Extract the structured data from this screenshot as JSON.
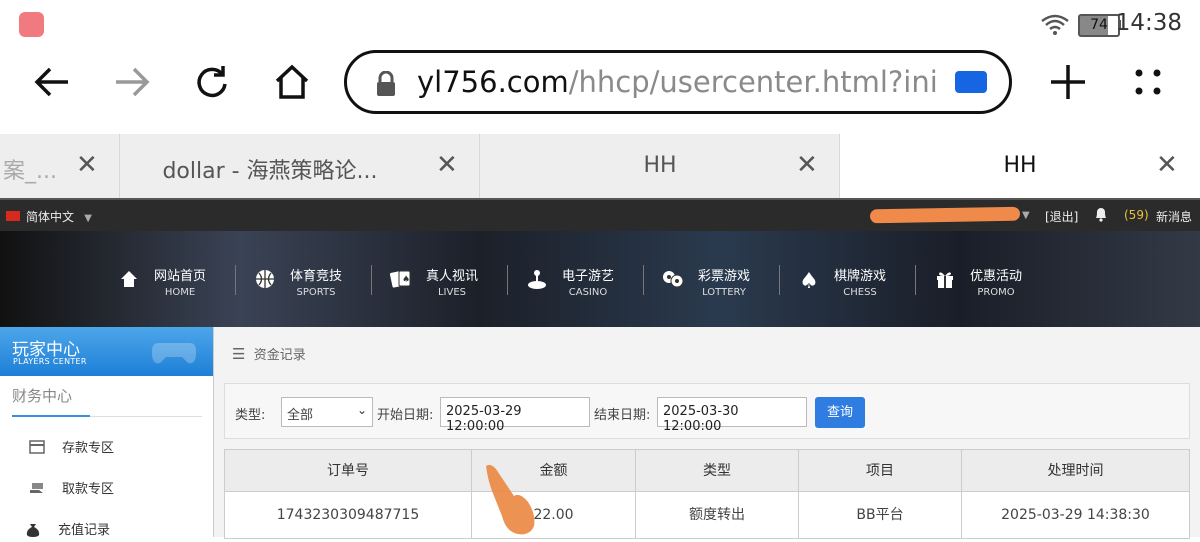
{
  "status": {
    "time": "14:38",
    "battery": "74",
    "wifi_icon": "wifi-icon",
    "notification_app_icon": "shopping-app-icon"
  },
  "toolbar": {
    "back_icon": "arrow-left-icon",
    "forward_icon": "arrow-right-icon",
    "reload_icon": "reload-icon",
    "home_icon": "home-icon",
    "url_host": "yl756.com",
    "url_path": "/hhcp/usercenter.html?ini",
    "new_tab_icon": "plus-icon",
    "menu_icon": "more-dots-icon"
  },
  "tabs": [
    {
      "label": "案_...",
      "active": false
    },
    {
      "label": "dollar - 海燕策略论...",
      "active": false
    },
    {
      "label": "HH",
      "active": false
    },
    {
      "label": "HH",
      "active": true
    }
  ],
  "sitebar": {
    "language": "简体中文",
    "logout": "[退出]",
    "message_count": "(59)",
    "message_label": "新消息"
  },
  "nav": [
    {
      "zh": "网站首页",
      "en": "HOME",
      "icon": "home-icon",
      "glyph": "⌂"
    },
    {
      "zh": "体育竞技",
      "en": "SPORTS",
      "icon": "basketball-icon",
      "glyph": "◉"
    },
    {
      "zh": "真人视讯",
      "en": "LIVES",
      "icon": "cards-icon",
      "glyph": "🂡"
    },
    {
      "zh": "电子游艺",
      "en": "CASINO",
      "icon": "joystick-icon",
      "glyph": "⚲"
    },
    {
      "zh": "彩票游戏",
      "en": "LOTTERY",
      "icon": "lottery-balls-icon",
      "glyph": "●"
    },
    {
      "zh": "棋牌游戏",
      "en": "CHESS",
      "icon": "spade-icon",
      "glyph": "♠"
    },
    {
      "zh": "优惠活动",
      "en": "PROMO",
      "icon": "gift-icon",
      "glyph": "✚"
    }
  ],
  "sidebar": {
    "title": "玩家中心",
    "subtitle": "PLAYERS CENTER",
    "section": "财务中心",
    "items": [
      {
        "label": "存款专区",
        "icon": "deposit-icon"
      },
      {
        "label": "取款专区",
        "icon": "withdraw-icon"
      },
      {
        "label": "充值记录",
        "icon": "money-bag-icon"
      }
    ]
  },
  "main": {
    "breadcrumb": "资金记录",
    "filter": {
      "type_label": "类型:",
      "type_value": "全部",
      "start_label": "开始日期:",
      "start_value": "2025-03-29 12:00:00",
      "end_label": "结束日期:",
      "end_value": "2025-03-30 12:00:00",
      "query_button": "查询"
    },
    "table": {
      "headers": [
        "订单号",
        "金额",
        "类型",
        "项目",
        "处理时间"
      ],
      "rows": [
        [
          "1743230309487715",
          "22.00",
          "额度转出",
          "BB平台",
          "2025-03-29 14:38:30"
        ]
      ]
    }
  }
}
